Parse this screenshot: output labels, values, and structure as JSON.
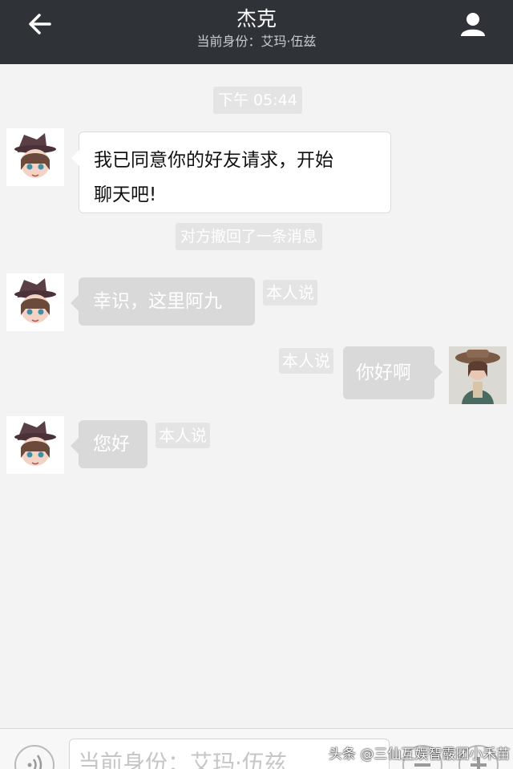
{
  "header": {
    "title": "杰克",
    "subtitle": "当前身份：艾玛·伍兹",
    "back_icon": "arrow-left-icon",
    "profile_icon": "user-icon"
  },
  "messages": {
    "timestamp": "下午 05:44",
    "greeting": "我已同意你的好友请求，开始聊天吧!",
    "greeting_line1": "我已同意你的好友请求，开始",
    "greeting_line2": "聊天吧!",
    "recall_notice": "对方撤回了一条消息",
    "msg1": "幸识，这里阿九",
    "msg2": "你好啊",
    "msg3": "您好",
    "self_tag": "本人说"
  },
  "input": {
    "placeholder": "当前身份：艾玛·伍兹"
  },
  "watermark": "头条 @三仙互娱智霰团小禾苗",
  "colors": {
    "header_bg": "#2f3337",
    "chat_bg": "#f3f3f3",
    "bubble_gray": "#d9d9d9",
    "tag_gray": "#e4e4e4"
  }
}
